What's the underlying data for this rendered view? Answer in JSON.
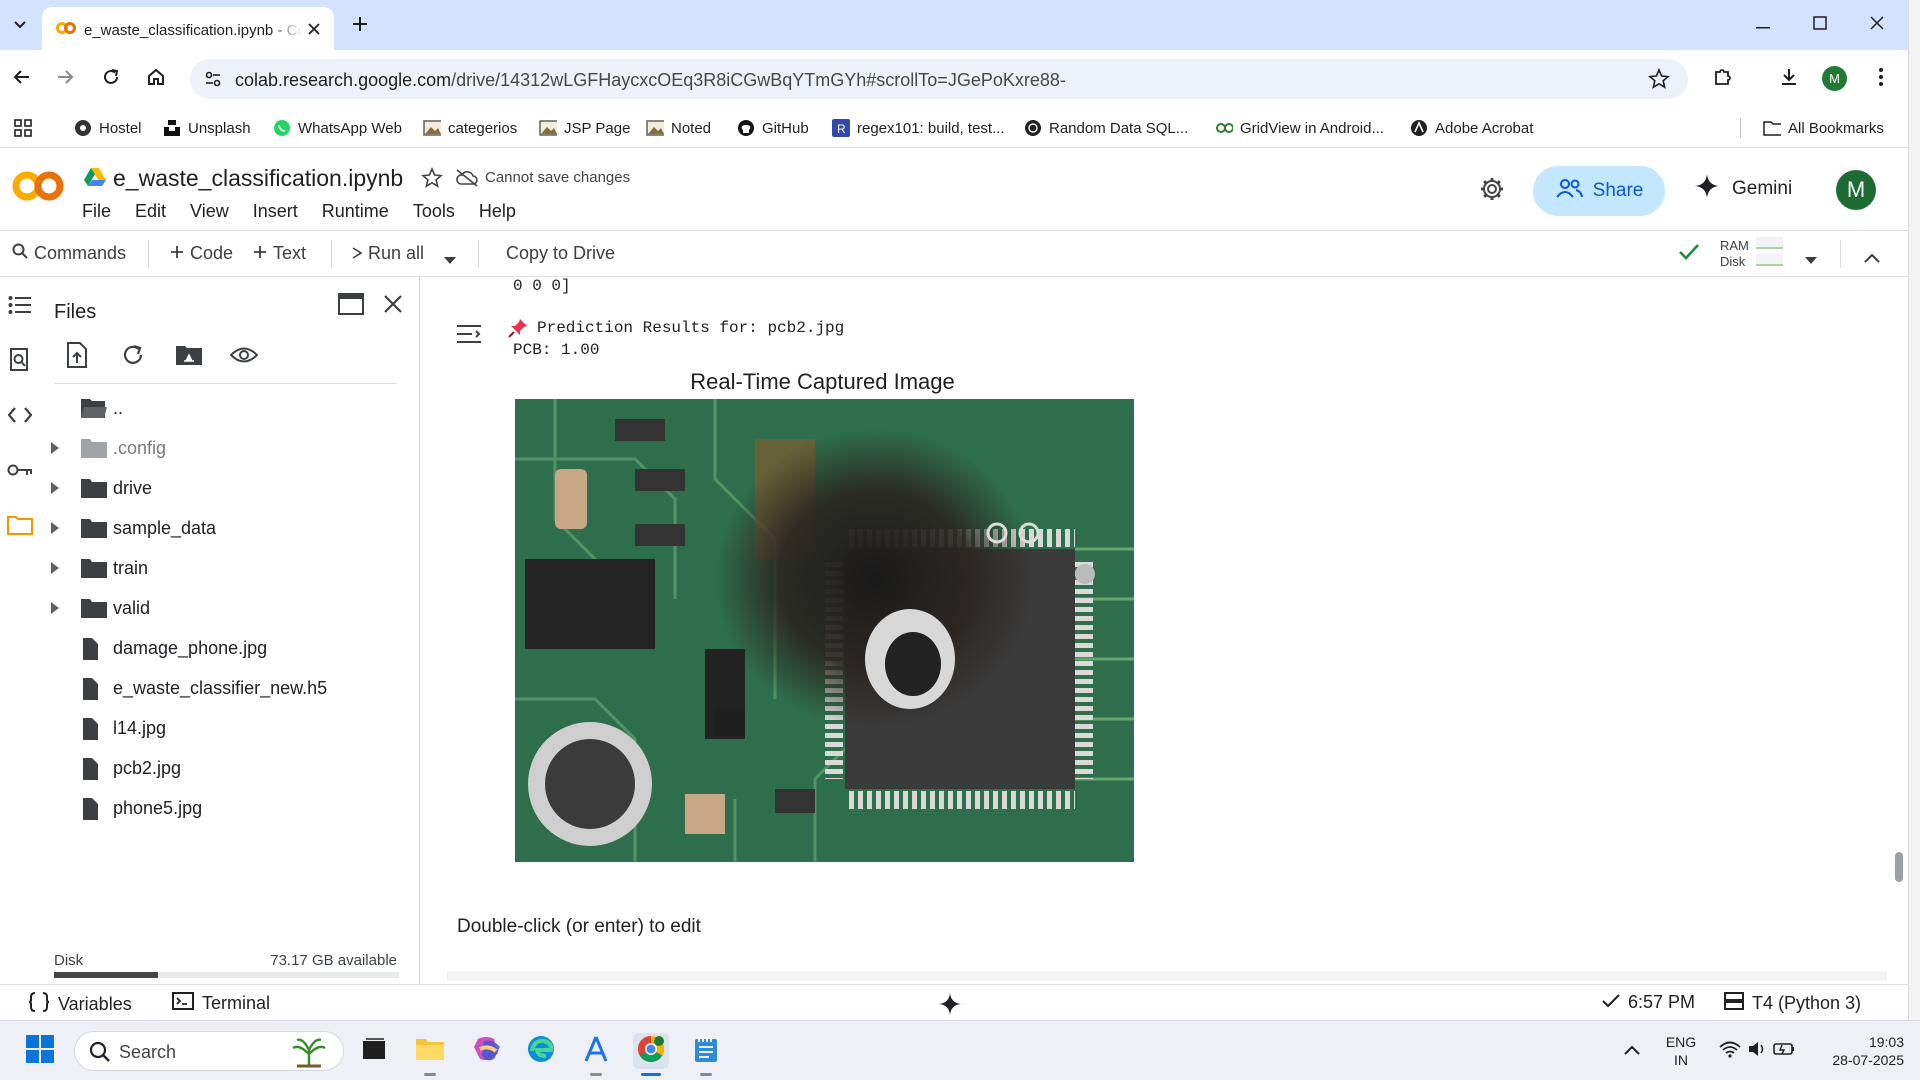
{
  "browser": {
    "tab_title": "e_waste_classification.ipynb - Colab",
    "url_host": "colab.research.google.com",
    "url_path": "/drive/14312wLGFHaycxcOEq3R8iCGwBqYTmGYh#scrollTo=JGePoKxre88-",
    "profile_initial": "M",
    "bookmarks": [
      {
        "label": "Hostel",
        "icon": "circle-globe-icon"
      },
      {
        "label": "Unsplash",
        "icon": "unsplash-icon"
      },
      {
        "label": "WhatsApp Web",
        "icon": "whatsapp-icon"
      },
      {
        "label": "categerios",
        "icon": "image-bookmark-icon"
      },
      {
        "label": "JSP Page",
        "icon": "image-bookmark-icon"
      },
      {
        "label": "Noted",
        "icon": "image-bookmark-icon"
      },
      {
        "label": "GitHub",
        "icon": "github-icon"
      },
      {
        "label": "regex101: build, test...",
        "icon": "regex-icon"
      },
      {
        "label": "Random Data SQL...",
        "icon": "circle-globe-icon"
      },
      {
        "label": "GridView in Android...",
        "icon": "link-icon"
      },
      {
        "label": "Adobe Acrobat",
        "icon": "acrobat-icon"
      }
    ],
    "all_bookmarks": "All Bookmarks"
  },
  "colab": {
    "notebook_title": "e_waste_classification.ipynb",
    "save_status": "Cannot save changes",
    "menu": [
      "File",
      "Edit",
      "View",
      "Insert",
      "Runtime",
      "Tools",
      "Help"
    ],
    "share_label": "Share",
    "gemini_label": "Gemini",
    "user_initial": "M",
    "toolbar": {
      "commands": "Commands",
      "code": "Code",
      "text": "Text",
      "run_all": "Run all",
      "copy_to_drive": "Copy to Drive",
      "ram": "RAM",
      "disk": "Disk"
    }
  },
  "files": {
    "title": "Files",
    "tree": [
      {
        "label": "..",
        "type": "parent",
        "expandable": false
      },
      {
        "label": ".config",
        "type": "folder-dim",
        "expandable": true
      },
      {
        "label": "drive",
        "type": "folder",
        "expandable": true
      },
      {
        "label": "sample_data",
        "type": "folder",
        "expandable": true
      },
      {
        "label": "train",
        "type": "folder",
        "expandable": true
      },
      {
        "label": "valid",
        "type": "folder",
        "expandable": true
      },
      {
        "label": "damage_phone.jpg",
        "type": "file",
        "expandable": false
      },
      {
        "label": "e_waste_classifier_new.h5",
        "type": "file",
        "expandable": false
      },
      {
        "label": "l14.jpg",
        "type": "file",
        "expandable": false
      },
      {
        "label": "pcb2.jpg",
        "type": "file",
        "expandable": false
      },
      {
        "label": "phone5.jpg",
        "type": "file",
        "expandable": false
      }
    ],
    "disk_label": "Disk",
    "disk_available": "73.17 GB available",
    "disk_used_fraction": 0.3
  },
  "output": {
    "prev_line": "0 0 0]",
    "prediction_line": "Prediction Results for: pcb2.jpg",
    "score_line": "PCB: 1.00",
    "image_title": "Real-Time Captured Image",
    "markdown_placeholder": "Double-click (or enter) to edit"
  },
  "statusbar": {
    "variables": "Variables",
    "terminal": "Terminal",
    "time": "6:57 PM",
    "runtime": "T4 (Python 3)"
  },
  "taskbar": {
    "search": "Search",
    "lang_top": "ENG",
    "lang_bottom": "IN",
    "clock_time": "19:03",
    "clock_date": "28-07-2025"
  },
  "colors": {
    "tabstrip": "#d3e3fd",
    "share_bg": "#c2e7ff",
    "share_fg": "#0b57d0",
    "colab_orange": "#f9ab00",
    "accent_green": "#1e8e3e"
  }
}
